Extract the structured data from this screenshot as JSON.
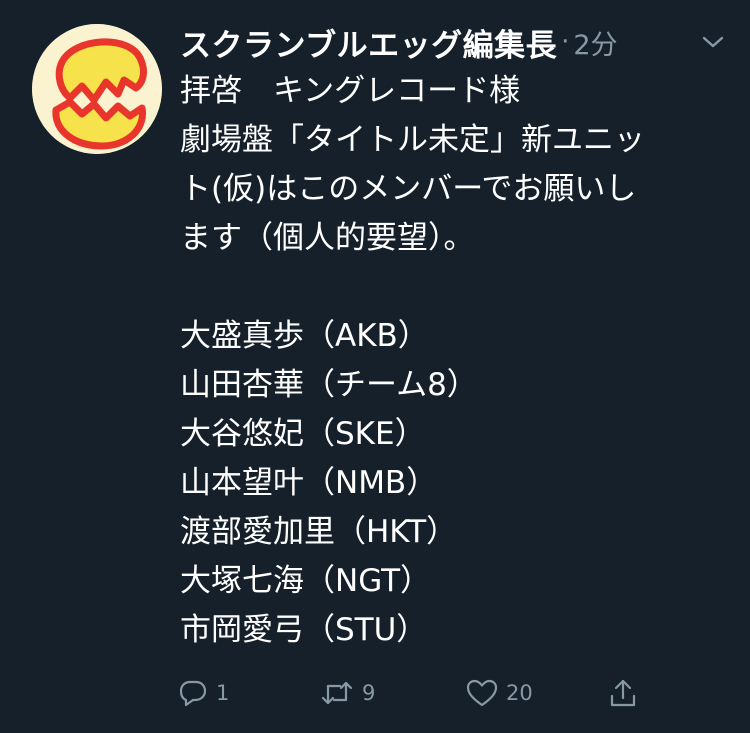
{
  "tweet": {
    "author_name": "スクランブルエッグ編集長",
    "separator": "·",
    "time": "2分",
    "lines": [
      "拝啓　キングレコード様",
      "劇場盤「タイトル未定」新ユニッ",
      "ト(仮)はこのメンバーでお願いし",
      "ます（個人的要望）。",
      "",
      "大盛真歩（AKB）",
      "山田杏華（チーム8）",
      "大谷悠妃（SKE）",
      "山本望叶（NMB）",
      "渡部愛加里（HKT）",
      "大塚七海（NGT）",
      "市岡愛弓（STU）"
    ]
  },
  "actions": {
    "reply_count": "1",
    "retweet_count": "9",
    "like_count": "20"
  },
  "icons": {
    "avatar": "scrambled-egg-avatar",
    "caret": "chevron-down-icon",
    "reply": "reply-icon",
    "retweet": "retweet-icon",
    "like": "heart-icon",
    "share": "share-icon"
  },
  "colors": {
    "background": "#15202b",
    "primary_text": "#ffffff",
    "secondary_text": "#8899a6",
    "avatar_red": "#e8362c",
    "avatar_yellow": "#f6e24a"
  }
}
